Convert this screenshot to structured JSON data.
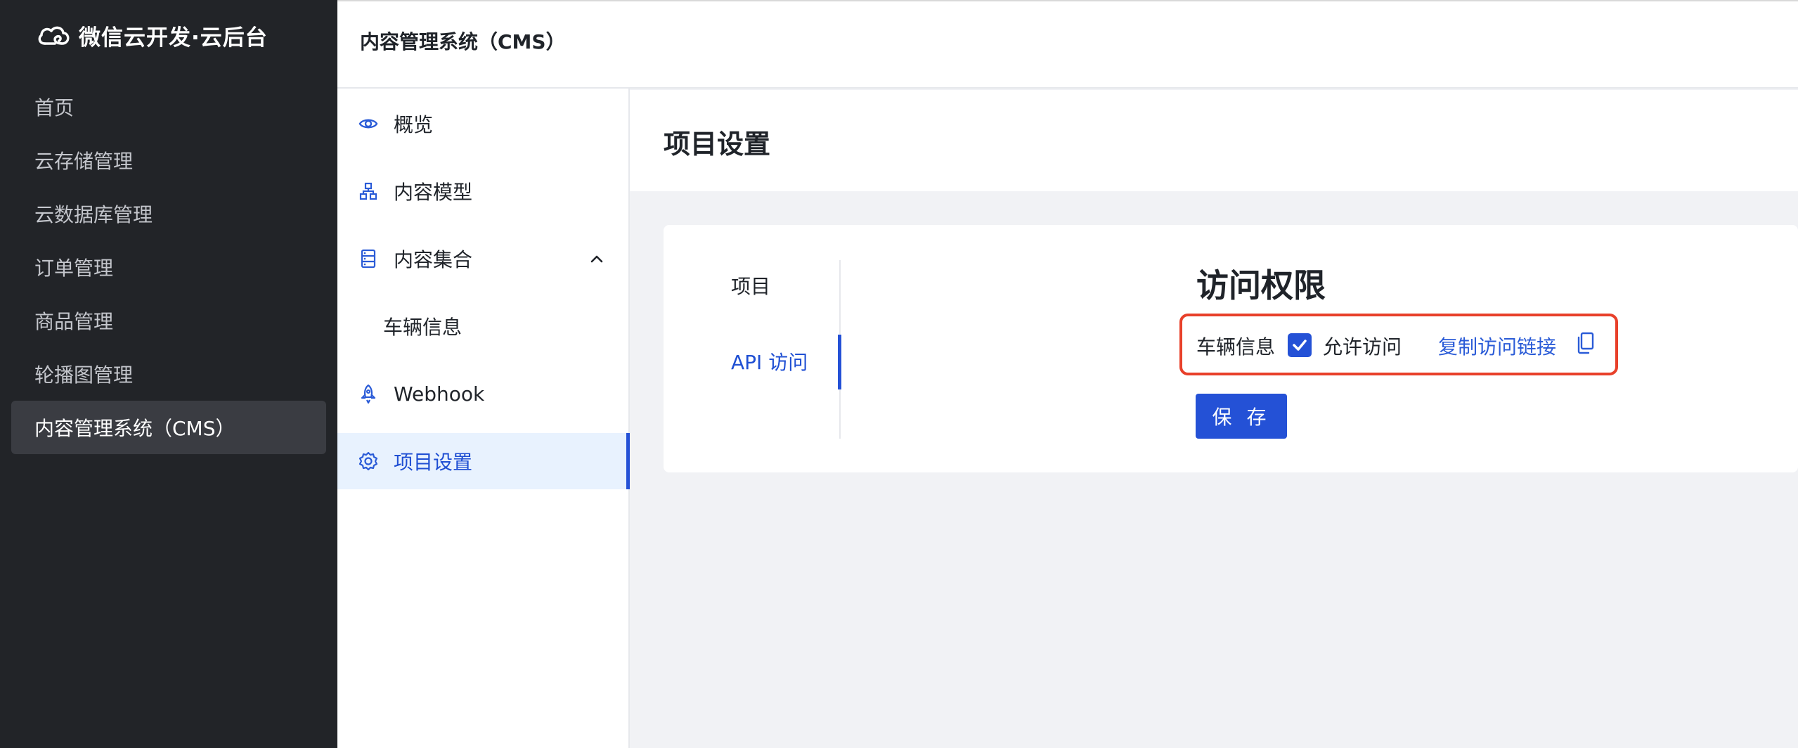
{
  "brand": {
    "name": "微信云开发·云后台"
  },
  "nav": {
    "items": [
      {
        "label": "首页"
      },
      {
        "label": "云存储管理"
      },
      {
        "label": "云数据库管理"
      },
      {
        "label": "订单管理"
      },
      {
        "label": "商品管理"
      },
      {
        "label": "轮播图管理"
      },
      {
        "label": "内容管理系统（CMS）",
        "active": true
      }
    ]
  },
  "header": {
    "title": "内容管理系统（CMS）"
  },
  "cms_nav": {
    "overview": "概览",
    "models": "内容模型",
    "collections": "内容集合",
    "collection_child": "车辆信息",
    "webhook": "Webhook",
    "settings": "项目设置"
  },
  "page": {
    "title": "项目设置"
  },
  "settings_tabs": {
    "project": "项目",
    "api_access": "API 访问"
  },
  "access": {
    "title": "访问权限",
    "collection_name": "车辆信息",
    "allow_label": "允许访问",
    "allow_checked": true,
    "copy_link_label": "复制访问链接"
  },
  "actions": {
    "save_label": "保 存"
  },
  "colors": {
    "accent": "#2451d6",
    "highlight": "#e8402a",
    "nav_bg": "#222428"
  }
}
